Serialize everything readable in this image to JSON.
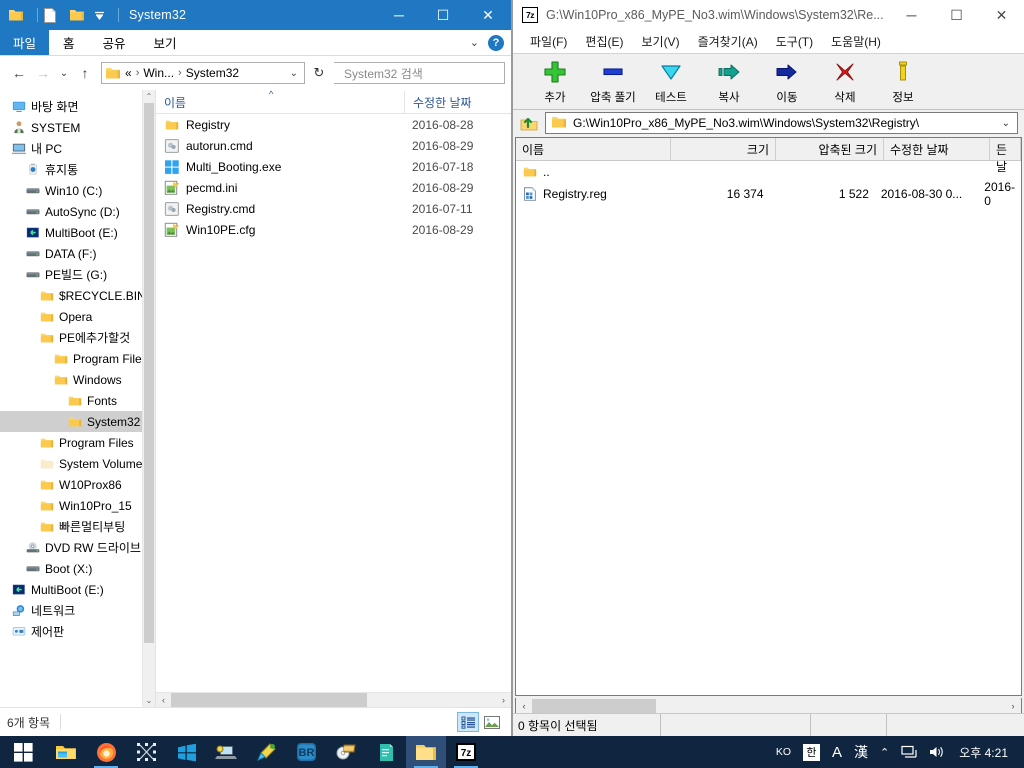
{
  "explorer": {
    "title": "System32",
    "titlebar_icons": [
      "folder-icon",
      "document-icon",
      "folder-icon",
      "dropdown-icon"
    ],
    "caption": {
      "minimize": "─",
      "maximize": "☐",
      "close": "✕"
    },
    "ribbon": {
      "file_tab": "파일",
      "tabs": [
        "홈",
        "공유",
        "보기"
      ],
      "expand": "⌄",
      "help": "?"
    },
    "nav": {
      "back": "←",
      "forward": "→",
      "recent": "⌄",
      "up": "↑",
      "crumbs": [
        "«",
        "Win...",
        "System32"
      ],
      "crumb_sep": "›",
      "dropdown": "⌄",
      "refresh": "↻",
      "search_placeholder": "System32 검색"
    },
    "tree": [
      {
        "label": "바탕 화면",
        "icon": "desktop-icon",
        "indent": 0
      },
      {
        "label": "SYSTEM",
        "icon": "user-icon",
        "indent": 0
      },
      {
        "label": "내 PC",
        "icon": "computer-icon",
        "indent": 0
      },
      {
        "label": "휴지통",
        "icon": "recyclebin-icon",
        "indent": 1
      },
      {
        "label": "Win10 (C:)",
        "icon": "drive-icon",
        "indent": 1
      },
      {
        "label": "AutoSync (D:)",
        "icon": "drive-icon",
        "indent": 1
      },
      {
        "label": "MultiBoot (E:)",
        "icon": "optical-drive-icon",
        "indent": 1
      },
      {
        "label": "DATA (F:)",
        "icon": "drive-icon",
        "indent": 1
      },
      {
        "label": "PE빌드 (G:)",
        "icon": "drive-icon",
        "indent": 1
      },
      {
        "label": "$RECYCLE.BIN",
        "icon": "folder-icon",
        "indent": 2
      },
      {
        "label": "Opera",
        "icon": "folder-icon",
        "indent": 2
      },
      {
        "label": "PE에추가할것",
        "icon": "folder-icon",
        "indent": 2
      },
      {
        "label": "Program Files",
        "icon": "folder-icon",
        "indent": 3
      },
      {
        "label": "Windows",
        "icon": "folder-icon",
        "indent": 3
      },
      {
        "label": "Fonts",
        "icon": "folder-icon",
        "indent": 4
      },
      {
        "label": "System32",
        "icon": "folder-icon",
        "indent": 4,
        "selected": true
      },
      {
        "label": "Program Files",
        "icon": "folder-icon",
        "indent": 2
      },
      {
        "label": "System Volume Inf",
        "icon": "folder-dim-icon",
        "indent": 2
      },
      {
        "label": "W10Prox86",
        "icon": "folder-icon",
        "indent": 2
      },
      {
        "label": "Win10Pro_15",
        "icon": "folder-icon",
        "indent": 2
      },
      {
        "label": "빠른멀티부팅",
        "icon": "folder-icon",
        "indent": 2
      },
      {
        "label": "DVD RW 드라이브",
        "icon": "optical-disc-icon",
        "indent": 1
      },
      {
        "label": "Boot (X:)",
        "icon": "drive-icon",
        "indent": 1
      },
      {
        "label": "MultiBoot (E:)",
        "icon": "optical-drive-icon",
        "indent": 0
      },
      {
        "label": "네트워크",
        "icon": "network-icon",
        "indent": 0
      },
      {
        "label": "제어판",
        "icon": "controlpanel-icon",
        "indent": 0
      }
    ],
    "columns": {
      "name": "이름",
      "modified": "수정한 날짜"
    },
    "files": [
      {
        "name": "Registry",
        "icon": "folder-icon",
        "modified": "2016-08-28"
      },
      {
        "name": "autorun.cmd",
        "icon": "cmd-icon",
        "modified": "2016-08-29"
      },
      {
        "name": "Multi_Booting.exe",
        "icon": "windows-exe-icon",
        "modified": "2016-07-18"
      },
      {
        "name": "pecmd.ini",
        "icon": "ini-icon",
        "modified": "2016-08-29"
      },
      {
        "name": "Registry.cmd",
        "icon": "cmd-icon",
        "modified": "2016-07-11"
      },
      {
        "name": "Win10PE.cfg",
        "icon": "ini-icon",
        "modified": "2016-08-29"
      }
    ],
    "status": "6개 항목",
    "view_buttons": [
      "details-view-icon",
      "thumbnail-view-icon"
    ],
    "scroll_arrows": {
      "left": "‹",
      "right": "›",
      "up": "⌃",
      "down": "⌄"
    }
  },
  "sevenzip": {
    "logo": "7z",
    "title": "G:\\Win10Pro_x86_MyPE_No3.wim\\Windows\\System32\\Re...",
    "caption": {
      "minimize": "─",
      "maximize": "☐",
      "close": "✕"
    },
    "menu": [
      "파일(F)",
      "편집(E)",
      "보기(V)",
      "즐겨찾기(A)",
      "도구(T)",
      "도움말(H)"
    ],
    "toolbar": [
      {
        "label": "추가",
        "icon": "plus-icon"
      },
      {
        "label": "압축 풀기",
        "icon": "extract-icon"
      },
      {
        "label": "테스트",
        "icon": "test-icon"
      },
      {
        "label": "복사",
        "icon": "copy-icon"
      },
      {
        "label": "이동",
        "icon": "move-icon"
      },
      {
        "label": "삭제",
        "icon": "delete-icon"
      },
      {
        "label": "정보",
        "icon": "info-icon"
      }
    ],
    "up_icon": "up-folder-icon",
    "path": "G:\\Win10Pro_x86_MyPE_No3.wim\\Windows\\System32\\Registry\\",
    "path_dropdown": "⌄",
    "columns": [
      "이름",
      "크기",
      "압축된 크기",
      "수정한 날짜",
      "만든 날"
    ],
    "rows": [
      {
        "name": "..",
        "icon": "folder-icon",
        "size": "",
        "packed": "",
        "modified": "",
        "created": ""
      },
      {
        "name": "Registry.reg",
        "icon": "reg-icon",
        "size": "16 374",
        "packed": "1 522",
        "modified": "2016-08-30 0...",
        "created": "2016-0"
      }
    ],
    "status": "0 항목이 선택됨",
    "scroll_arrows": {
      "left": "‹",
      "right": "›"
    }
  },
  "taskbar": {
    "start": "start-icon",
    "items": [
      {
        "icon": "file-explorer-icon",
        "open": false
      },
      {
        "icon": "firefox-icon",
        "open": true
      },
      {
        "icon": "selection-tool-icon",
        "open": false
      },
      {
        "icon": "windows-logo-icon",
        "open": false
      },
      {
        "icon": "laptop-tool-icon",
        "open": false
      },
      {
        "icon": "paint-tool-icon",
        "open": false
      },
      {
        "icon": "br-app-icon",
        "open": false
      },
      {
        "icon": "burn-disc-icon",
        "open": false
      },
      {
        "icon": "teal-doc-icon",
        "open": false
      },
      {
        "icon": "folder-window-icon",
        "open": true,
        "active": true
      },
      {
        "icon": "7zip-icon",
        "open": true
      }
    ],
    "tray": {
      "lang": "KO",
      "ime_han": "한",
      "ime_a": "A",
      "ime_hanja": "漢",
      "overflow": "⌃",
      "network": "network-tray-icon",
      "volume": "volume-tray-icon"
    },
    "clock": "오후 4:21"
  }
}
